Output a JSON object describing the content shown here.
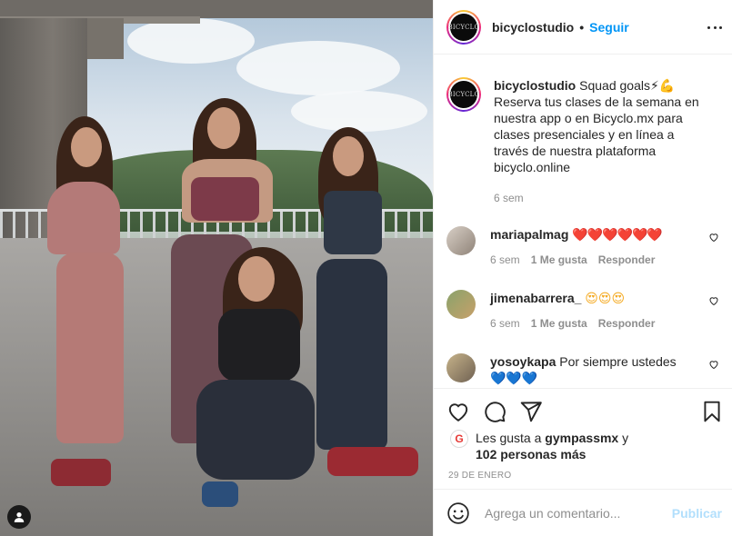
{
  "post": {
    "username": "bicyclostudio",
    "follow_label": "Seguir",
    "separator": "•",
    "avatar_text": "BICYCLO"
  },
  "caption": {
    "username": "bicyclostudio",
    "text": "Squad goals⚡💪 Reserva tus clases de la semana en nuestra app o en Bicyclo.mx para clases presenciales y en línea a través de nuestra plataforma bicyclo.online",
    "time": "6 sem"
  },
  "comments": [
    {
      "username": "mariapalmag",
      "text": "❤️❤️❤️❤️❤️❤️",
      "time": "6 sem",
      "likes": "1 Me gusta",
      "reply": "Responder"
    },
    {
      "username": "jimenabarrera_",
      "text": "😍😍😍",
      "time": "6 sem",
      "likes": "1 Me gusta",
      "reply": "Responder"
    },
    {
      "username": "yosoykapa",
      "text": "Por siempre ustedes 💙💙💙"
    }
  ],
  "likes": {
    "prefix": "Les gusta a ",
    "user": "gympassmx",
    "mid": " y",
    "others": "102 personas más",
    "avatar_letter": "G"
  },
  "date": "29 DE ENERO",
  "composer": {
    "placeholder": "Agrega un comentario...",
    "publish_label": "Publicar"
  },
  "colors": {
    "accent": "#0095f6",
    "publish_disabled": "#b2dffc",
    "muted": "#8e8e8e"
  }
}
